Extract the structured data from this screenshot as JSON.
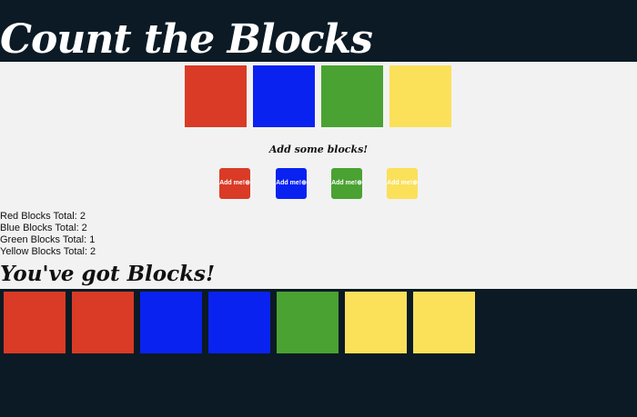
{
  "app": {
    "title": "Count the Blocks"
  },
  "colors": {
    "red": "#d93b26",
    "blue": "#0a22f0",
    "green": "#4aa232",
    "yellow": "#fbe05a"
  },
  "palette": [
    "red",
    "blue",
    "green",
    "yellow"
  ],
  "controls": {
    "prompt": "Add some blocks!",
    "buttons": [
      {
        "color": "red",
        "label": "Add me!",
        "icon": "plus-circle-icon"
      },
      {
        "color": "blue",
        "label": "Add me!",
        "icon": "plus-circle-icon"
      },
      {
        "color": "green",
        "label": "Add me!",
        "icon": "plus-circle-icon"
      },
      {
        "color": "yellow",
        "label": "Add me!",
        "icon": "plus-circle-icon"
      }
    ]
  },
  "totals": [
    "Red Blocks Total: 2",
    "Blue Blocks Total: 2",
    "Green Blocks Total: 1",
    "Yellow Blocks Total: 2"
  ],
  "collection": {
    "heading": "You've got Blocks!",
    "blocks": [
      "red",
      "red",
      "blue",
      "blue",
      "green",
      "yellow",
      "yellow"
    ]
  }
}
